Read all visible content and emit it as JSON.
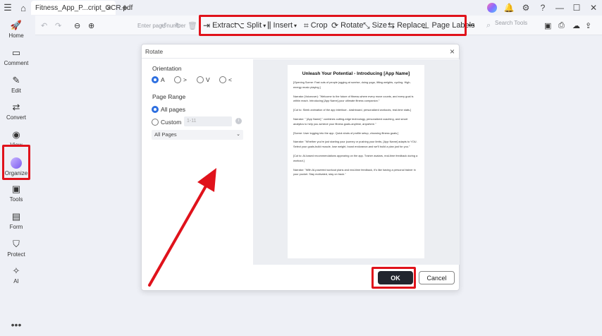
{
  "titlebar": {
    "doc_tab_title": "Fitness_App_P...cript_OCR.pdf",
    "new_tab": "+"
  },
  "sidebar": {
    "items": [
      {
        "label": "Home",
        "icon": "rocket-icon"
      },
      {
        "label": "Comment",
        "icon": "comment-icon"
      },
      {
        "label": "Edit",
        "icon": "edit-icon"
      },
      {
        "label": "Convert",
        "icon": "convert-icon"
      },
      {
        "label": "View",
        "icon": "eye-icon"
      },
      {
        "label": "Organize",
        "icon": "organize-icon"
      },
      {
        "label": "Tools",
        "icon": "toolbox-icon"
      },
      {
        "label": "Form",
        "icon": "form-icon"
      },
      {
        "label": "Protect",
        "icon": "shield-icon"
      },
      {
        "label": "AI",
        "icon": "ai-wand-icon"
      }
    ],
    "more": "•••",
    "active": "Organize"
  },
  "toolbar": {
    "page_number_placeholder": "Enter page number",
    "extract": "Extract",
    "split": "Split",
    "insert": "Insert",
    "crop": "Crop",
    "rotate": "Rotate",
    "size": "Size",
    "replace": "Replace",
    "page_labels": "Page Labels",
    "more": "•••",
    "search_placeholder": "Search Tools"
  },
  "dialog": {
    "title": "Rotate",
    "orientation_label": "Orientation",
    "orientation_options": [
      "A",
      ">",
      "V",
      "<"
    ],
    "orientation_selected": "A",
    "page_range_label": "Page Range",
    "all_pages": "All pages",
    "custom": "Custom",
    "custom_placeholder": "1-11",
    "page_subset": "All Pages",
    "ok": "OK",
    "cancel": "Cancel"
  },
  "preview_page": {
    "title": "Unleash Your Potential - Introducing [App Name]",
    "paragraphs": [
      "[Opening Scene: Fast cuts of people jogging at sunrise, doing yoga, lifting weights, cycling. High-energy music playing.]",
      "Narrator (Voiceover): \"Welcome to the future of fitness-where every move counts, and every goal is within reach. Introducing [App Name]-your ultimate fitness companion.\"",
      "[Cut to: Sleek animation of the app interface - dashboard, personalized workouts, real-time stats.]",
      "Narrator: \" [App Name] \" combines cutting-edge technology, personalized coaching, and smart analytics to help you achieve your fitness goals-anytime, anywhere.\"",
      "[Scene: User logging into the app. Quick shots of profile setup, choosing fitness goals.]",
      "Narrator: \"Whether you're just starting your journey or pushing your limits, [App Name] adapts to YOU. Select your goals-build muscle, lose weight, boost endurance-and we'll build a plan just for you.\"",
      "[Cut to: AI-based recommendations appearing on the app. Trainer avatars, real-time feedback during a workout.]",
      "Narrator: \"With AI-powered workout plans and real-time feedback, it's like having a personal trainer in your pocket. Stay motivated, stay on track.\""
    ]
  },
  "colors": {
    "highlight_red": "#e0121b",
    "accent_blue": "#2d6fe0",
    "ok_dark": "#22252e",
    "organize_purple": "#7b5cf0"
  }
}
